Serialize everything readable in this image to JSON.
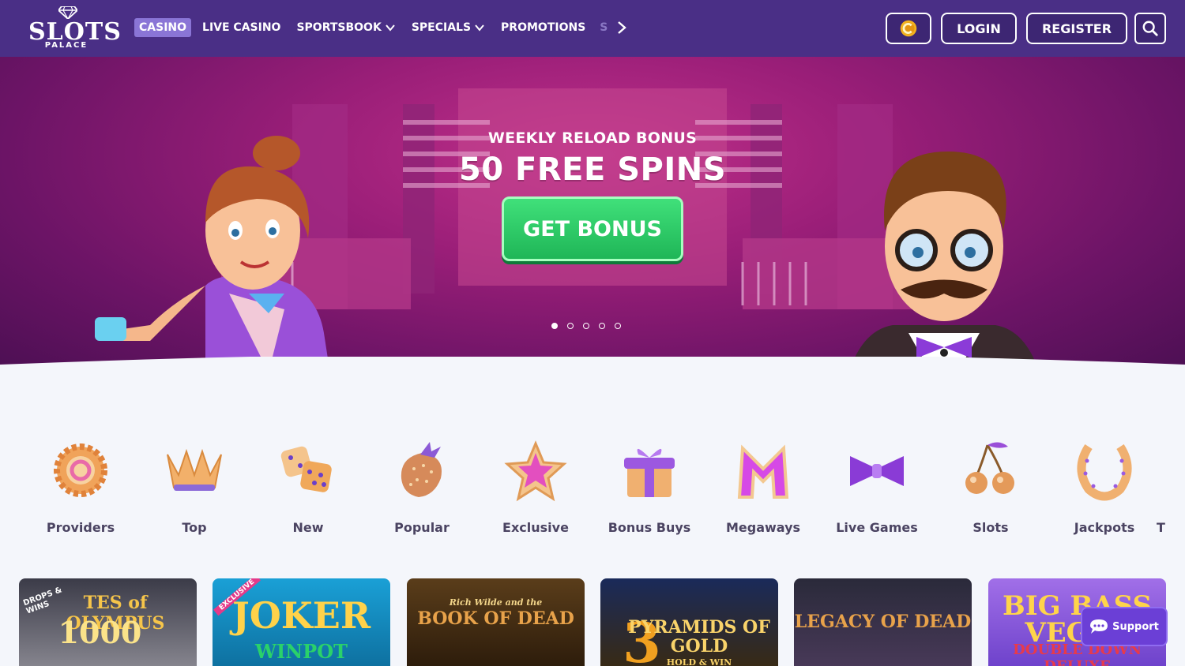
{
  "header": {
    "logo_text": "SLOTS",
    "logo_sub": "PALACE",
    "nav": [
      {
        "label": "CASINO",
        "active": true,
        "dropdown": false
      },
      {
        "label": "LIVE CASINO",
        "active": false,
        "dropdown": false
      },
      {
        "label": "SPORTSBOOK",
        "active": false,
        "dropdown": true
      },
      {
        "label": "SPECIALS",
        "active": false,
        "dropdown": true
      },
      {
        "label": "PROMOTIONS",
        "active": false,
        "dropdown": false
      }
    ],
    "nav_overflow_text": "S",
    "login_label": "LOGIN",
    "register_label": "REGISTER",
    "coin_icon": "coin-icon",
    "search_icon": "search-icon",
    "bg_color": "#4a2f86"
  },
  "hero": {
    "subtitle": "WEEKLY RELOAD BONUS",
    "title": "50 FREE SPINS",
    "cta_label": "GET BONUS",
    "slides_total": 5,
    "slide_active": 1,
    "cta_color": "#2ccb68"
  },
  "categories": [
    {
      "label": "Providers",
      "icon": "gear-icon"
    },
    {
      "label": "Top",
      "icon": "crown-icon"
    },
    {
      "label": "New",
      "icon": "dice-icon"
    },
    {
      "label": "Popular",
      "icon": "strawberry-icon"
    },
    {
      "label": "Exclusive",
      "icon": "star-icon"
    },
    {
      "label": "Bonus Buys",
      "icon": "gift-icon"
    },
    {
      "label": "Megaways",
      "icon": "m-letter-icon"
    },
    {
      "label": "Live Games",
      "icon": "bowtie-icon"
    },
    {
      "label": "Slots",
      "icon": "cherries-icon"
    },
    {
      "label": "Jackpots",
      "icon": "horseshoe-icon"
    },
    {
      "label": "T",
      "icon": ""
    }
  ],
  "games": [
    {
      "title": "TES of OLYMPUS",
      "subtitle": "1000",
      "badge": "DROPS & WINS"
    },
    {
      "title": "JOKER",
      "subtitle": "WINPOT",
      "badge": "EXCLUSIVE"
    },
    {
      "title": "BOOK OF DEAD",
      "subtitle": "Rich Wilde and the",
      "badge": ""
    },
    {
      "title": "PYRAMIDS OF GOLD",
      "subtitle": "3",
      "badge": "HOLD & WIN"
    },
    {
      "title": "LEGACY OF DEAD",
      "subtitle": "",
      "badge": ""
    },
    {
      "title": "BIG BASS VEGAS",
      "subtitle": "DOUBLE DOWN DELUXE",
      "badge": ""
    }
  ],
  "support_label": "Support"
}
